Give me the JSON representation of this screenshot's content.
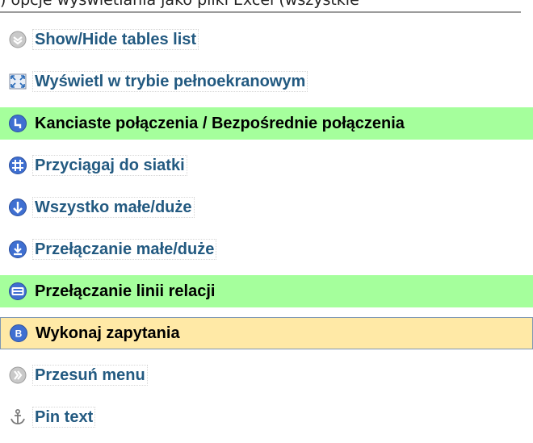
{
  "top": {
    "cut_text": ") opcje wyświetlania jako pliki Excel (wszystkie"
  },
  "menu": {
    "items": [
      {
        "label": "Show/Hide tables list",
        "icon": "show-hide-icon"
      },
      {
        "label": "Wyświetl w trybie pełnoekranowym",
        "icon": "fullscreen-icon"
      },
      {
        "label": "Kanciaste połączenia / Bezpośrednie połączenia",
        "icon": "angular-links-icon",
        "state": "active"
      },
      {
        "label": "Przyciągaj do siatki",
        "icon": "grid-icon"
      },
      {
        "label": "Wszystko małe/duże",
        "icon": "all-small-big-icon"
      },
      {
        "label": "Przełączanie małe/duże",
        "icon": "toggle-small-big-icon"
      },
      {
        "label": "Przełączanie linii relacji",
        "icon": "relation-lines-icon",
        "state": "active"
      },
      {
        "label": "Wykonaj zapytania",
        "icon": "exec-query-icon",
        "state": "hover"
      },
      {
        "label": "Przesuń menu",
        "icon": "move-menu-icon"
      },
      {
        "label": "Pin text",
        "icon": "anchor-icon"
      }
    ]
  },
  "colors": {
    "active_bg": "#a5ff9c",
    "hover_bg": "#ffe9a6",
    "link": "#235a81",
    "icon_blue": "#3f6fd1"
  }
}
